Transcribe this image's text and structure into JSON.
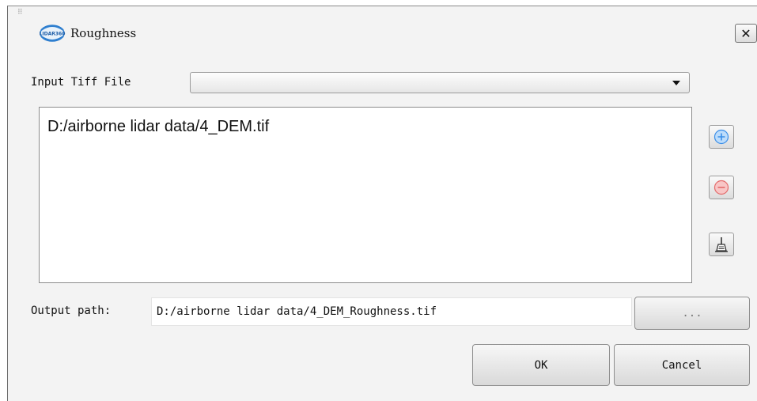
{
  "window": {
    "title": "Roughness",
    "logo_text": "LIDAR360",
    "close_glyph": "✕",
    "grip": "⠿"
  },
  "form": {
    "input_label": "Input Tiff File",
    "input_value": "",
    "files": [
      "D:/airborne lidar data/4_DEM.tif"
    ],
    "output_label": "Output path:",
    "output_value": "D:/airborne lidar data/4_DEM_Roughness.tif",
    "browse_label": "..."
  },
  "buttons": {
    "ok": "OK",
    "cancel": "Cancel"
  },
  "icons": {
    "add": "add-circle-icon",
    "remove": "remove-circle-icon",
    "clear": "broom-icon"
  },
  "colors": {
    "add_blue": "#3a8ee8",
    "remove_red": "#e36a6a"
  }
}
